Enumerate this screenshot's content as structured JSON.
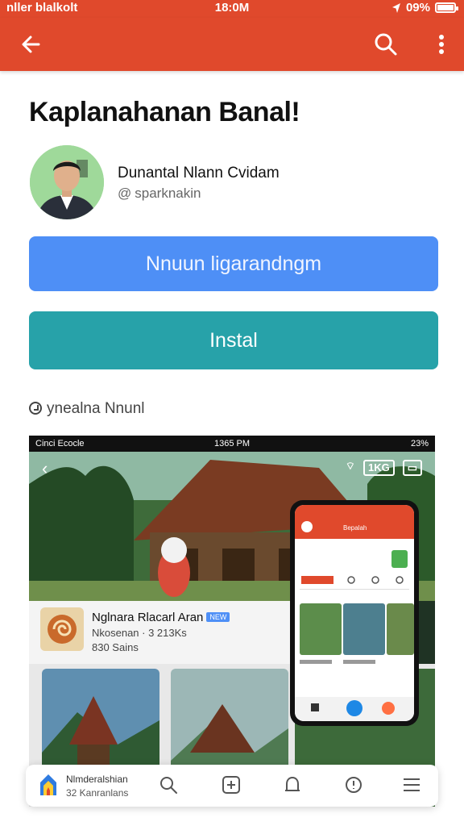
{
  "status_bar": {
    "carrier": "nller blalkolt",
    "time": "18:0M",
    "battery": "09%",
    "battery_level": 0.9
  },
  "toolbar": {
    "back_icon": "arrow-left-icon",
    "search_icon": "search-icon",
    "more_icon": "more-vertical-icon"
  },
  "app": {
    "title": "Kaplanahanan Banal!",
    "developer": "Dunantal Nlann Cvidam",
    "handle": "sparknakin",
    "primary_button": "Nnuun ligarandngm",
    "install_button": "Instal",
    "meta_text": "ynealna Nnunl"
  },
  "preview": {
    "status_left": "Cinci Ecocle",
    "status_time": "1365 PM",
    "status_right": "23%",
    "card_title": "Nglnara Rlacarl Aran",
    "card_badge": "NEW",
    "card_sub": "Nkosenan · 3 213Ks",
    "card_sub2": "830 Sains",
    "phone_title": "Bepalah"
  },
  "bottom_nav": {
    "title": "Nlmderalshian",
    "subtitle": "32 Kanranlans"
  },
  "colors": {
    "accent": "#e0492c",
    "primary_button": "#4e8ff6",
    "install_button": "#27a2a9"
  }
}
